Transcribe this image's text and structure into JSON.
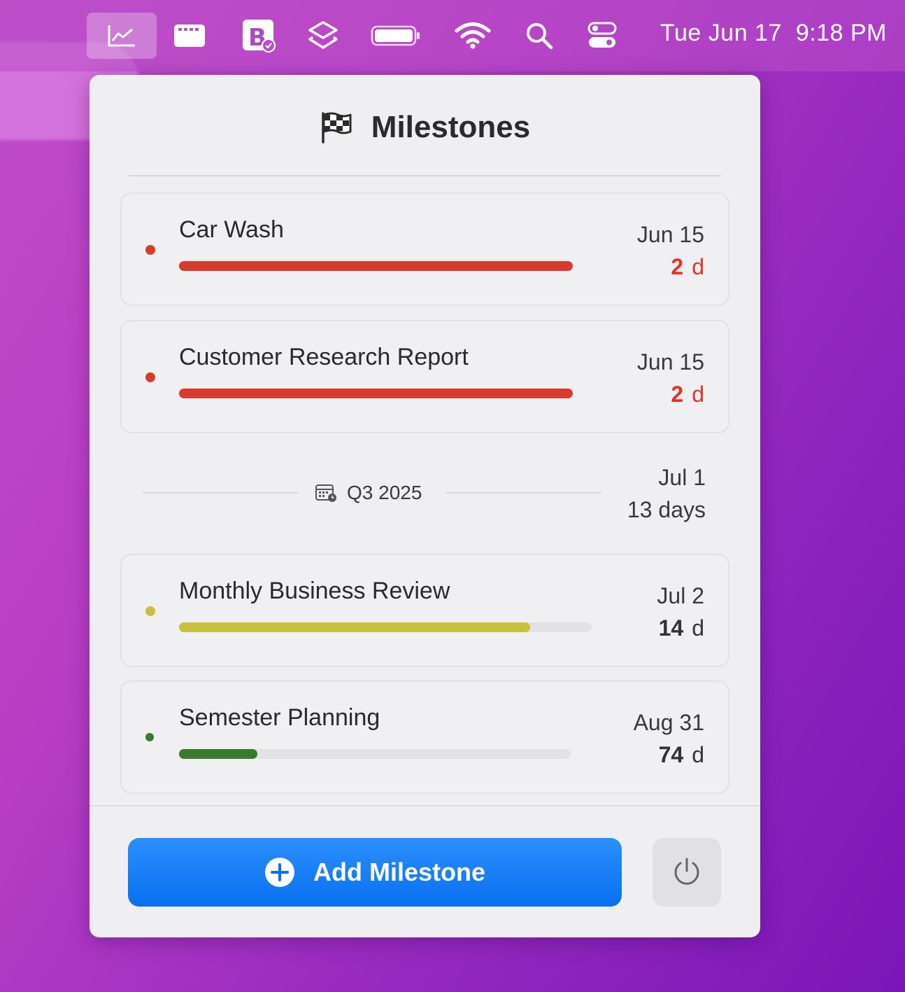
{
  "menubar": {
    "clock": {
      "date": "Tue Jun 17",
      "time": "9:18 PM"
    }
  },
  "panel": {
    "title": "Milestones",
    "milestones": [
      {
        "name": "Car Wash",
        "date": "Jun 15",
        "days": "2",
        "unit": "d",
        "progress": 1.0,
        "color": "#d93a2e",
        "days_color": "#e0332a"
      },
      {
        "name": "Customer Research Report",
        "date": "Jun 15",
        "days": "2",
        "unit": "d",
        "progress": 1.0,
        "color": "#d93a2e",
        "days_color": "#e0332a"
      }
    ],
    "section": {
      "label": "Q3 2025",
      "date": "Jul 1",
      "days": "13 days"
    },
    "milestones_q3": [
      {
        "name": "Monthly Business Review",
        "date": "Jul 2",
        "days": "14",
        "unit": "d",
        "progress": 0.85,
        "color": "#c8c13c",
        "days_color": "#333333"
      },
      {
        "name": "Semester Planning",
        "date": "Aug 31",
        "days": "74",
        "unit": "d",
        "progress": 0.2,
        "color": "#3a7a2e",
        "days_color": "#333333"
      }
    ],
    "add_button": {
      "label": "Add Milestone"
    }
  },
  "colors": {
    "accent": "#0a6ff0",
    "overdue": "#e0332a"
  },
  "icons": [
    "chart-icon",
    "calendar-bar-icon",
    "book-check-icon",
    "stack-icon",
    "battery-icon",
    "wifi-icon",
    "search-icon",
    "control-center-icon",
    "checkered-flag-icon",
    "calendar-icon",
    "plus-circle-icon",
    "power-icon"
  ]
}
